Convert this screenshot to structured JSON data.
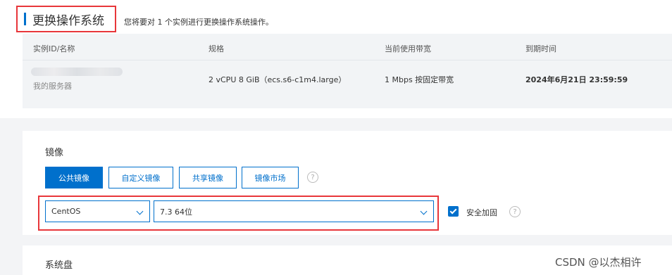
{
  "header": {
    "title": "更换操作系统",
    "subtitle": "您将要对 1 个实例进行更换操作系统操作。"
  },
  "instance_table": {
    "columns": [
      "实例ID/名称",
      "规格",
      "当前使用带宽",
      "到期时间"
    ],
    "rows": [
      {
        "name": "我的服务器",
        "spec": "2 vCPU 8 GiB（ecs.s6-c1m4.large）",
        "bandwidth": "1 Mbps 按固定带宽",
        "expiry": "2024年6月21日 23:59:59"
      }
    ]
  },
  "image": {
    "label": "镜像",
    "tabs": [
      "公共镜像",
      "自定义镜像",
      "共享镜像",
      "镜像市场"
    ],
    "active_tab": 0,
    "os_select": "CentOS",
    "version_select": "7.3 64位",
    "security_hardening_label": "安全加固",
    "security_hardening_checked": true,
    "help_glyph": "?"
  },
  "system_disk": {
    "label": "系统盘"
  },
  "watermark": "CSDN @以杰相许",
  "colors": {
    "accent": "#0070cc",
    "annotation": "#e8363a"
  }
}
